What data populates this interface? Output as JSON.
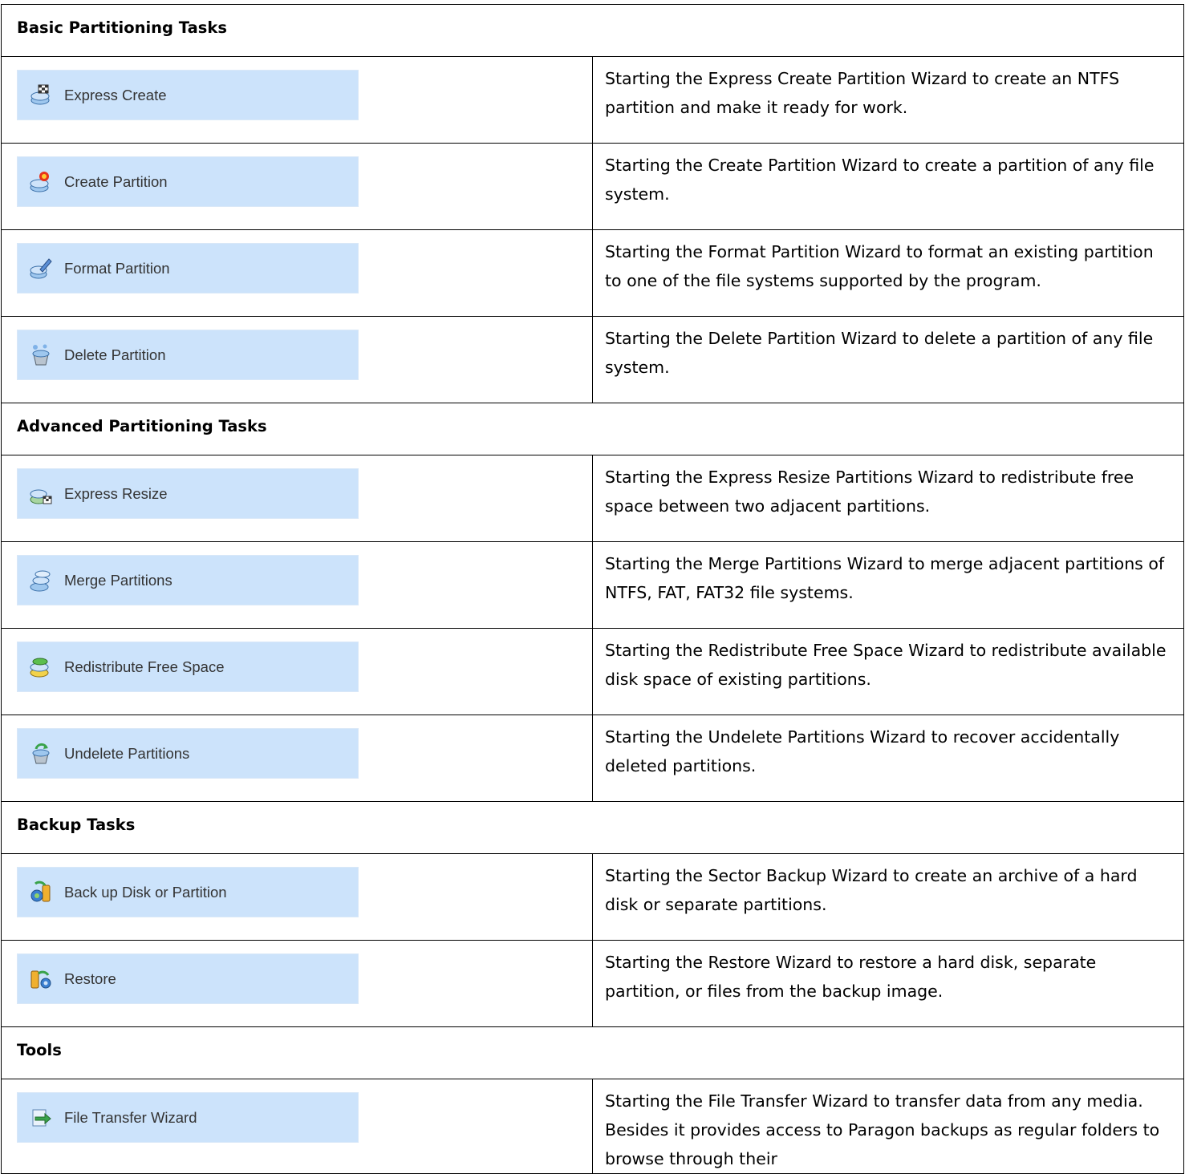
{
  "sections": [
    {
      "title": "Basic Partitioning Tasks",
      "rows": [
        {
          "label": "Express Create",
          "icon": "express-create-icon",
          "desc": "Starting the Express Create Partition Wizard to create an NTFS partition and make it ready for work."
        },
        {
          "label": "Create Partition",
          "icon": "create-partition-icon",
          "desc": "Starting the Create Partition Wizard to create a partition of any file system."
        },
        {
          "label": "Format Partition",
          "icon": "format-partition-icon",
          "desc": "Starting the Format Partition Wizard to format an existing partition to one of the file systems supported by the program."
        },
        {
          "label": "Delete Partition",
          "icon": "delete-partition-icon",
          "desc": "Starting the Delete Partition Wizard to delete a partition of any file system."
        }
      ]
    },
    {
      "title": "Advanced Partitioning Tasks",
      "rows": [
        {
          "label": "Express Resize",
          "icon": "express-resize-icon",
          "desc": "Starting the Express Resize Partitions Wizard to redistribute free space between two adjacent partitions."
        },
        {
          "label": "Merge Partitions",
          "icon": "merge-partitions-icon",
          "desc": "Starting the Merge Partitions Wizard to merge adjacent partitions of NTFS, FAT, FAT32 file systems."
        },
        {
          "label": "Redistribute Free Space",
          "icon": "redistribute-free-space-icon",
          "desc": "Starting the Redistribute Free Space Wizard to redistribute available disk space of existing partitions."
        },
        {
          "label": "Undelete Partitions",
          "icon": "undelete-partitions-icon",
          "desc": "Starting the Undelete Partitions Wizard to recover accidentally deleted partitions."
        }
      ]
    },
    {
      "title": "Backup Tasks",
      "rows": [
        {
          "label": "Back up Disk or Partition",
          "icon": "backup-disk-icon",
          "desc": "Starting the Sector Backup Wizard to create an archive of a hard disk or separate partitions."
        },
        {
          "label": "Restore",
          "icon": "restore-icon",
          "desc": "Starting the Restore Wizard to restore a hard disk, separate partition, or files from the backup image."
        }
      ]
    },
    {
      "title": "Tools",
      "rows": [
        {
          "label": "File Transfer Wizard",
          "icon": "file-transfer-wizard-icon",
          "desc": "Starting the File Transfer Wizard to transfer data from any media. Besides it provides access to Paragon backups as regular folders to browse through their"
        }
      ]
    }
  ]
}
